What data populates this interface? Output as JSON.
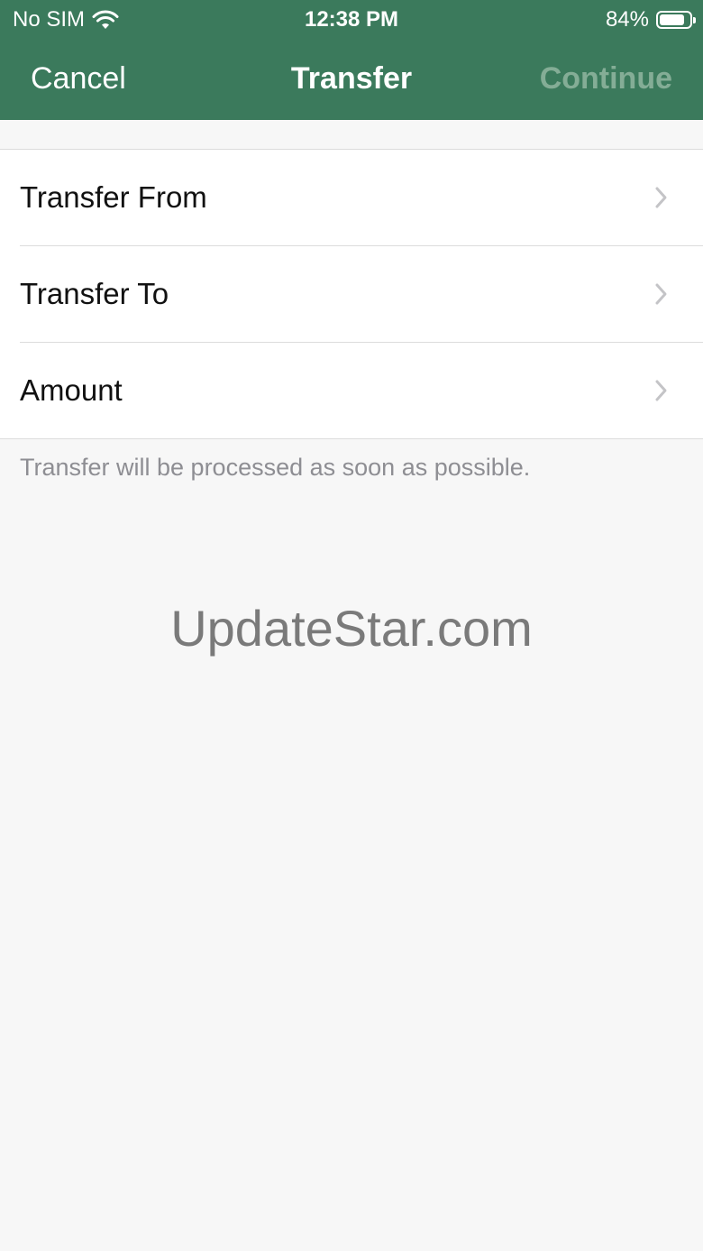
{
  "status_bar": {
    "carrier": "No SIM",
    "wifi_icon": "wifi-icon",
    "time": "12:38 PM",
    "battery_percent": "84%",
    "battery_level": 0.84,
    "battery_icon": "battery-icon"
  },
  "nav": {
    "cancel_label": "Cancel",
    "title": "Transfer",
    "continue_label": "Continue"
  },
  "rows": [
    {
      "label": "Transfer From",
      "icon": "chevron-right-icon"
    },
    {
      "label": "Transfer To",
      "icon": "chevron-right-icon"
    },
    {
      "label": "Amount",
      "icon": "chevron-right-icon"
    }
  ],
  "footer_note": "Transfer will be processed as soon as possible.",
  "watermark": "UpdateStar.com",
  "colors": {
    "header_bg": "#3b7a5c",
    "continue_disabled": "#84ad96",
    "background": "#f7f7f7"
  }
}
